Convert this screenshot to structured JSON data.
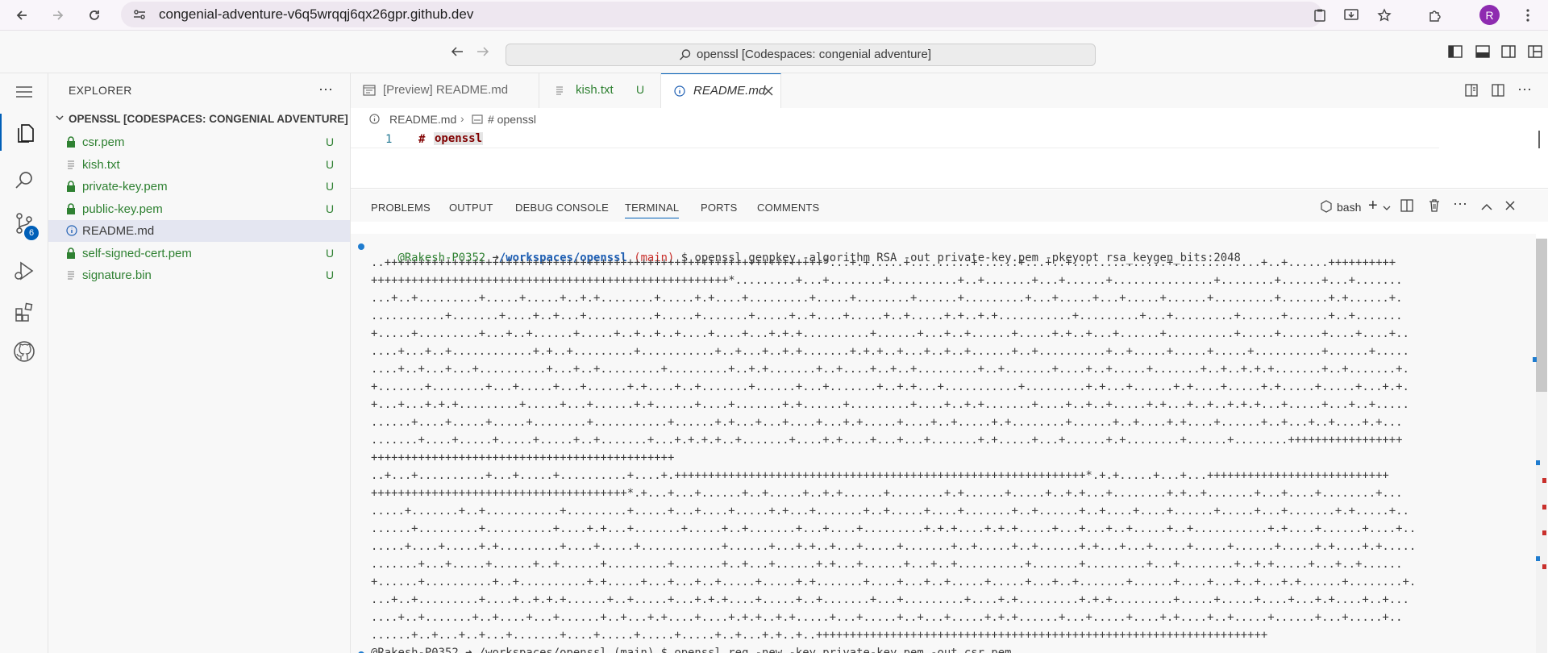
{
  "browser": {
    "url": "congenial-adventure-v6q5wrqqj6qx26gpr.github.dev",
    "avatar_letter": "R"
  },
  "titlebar": {
    "command_center": "openssl [Codespaces: congenial adventure]"
  },
  "activity": {
    "source_control_badge": "6"
  },
  "explorer": {
    "title": "EXPLORER",
    "folder": "OPENSSL [CODESPACES: CONGENIAL ADVENTURE]",
    "files": [
      {
        "name": "csr.pem",
        "status": "U"
      },
      {
        "name": "kish.txt",
        "status": "U"
      },
      {
        "name": "private-key.pem",
        "status": "U"
      },
      {
        "name": "public-key.pem",
        "status": "U"
      },
      {
        "name": "README.md",
        "status": ""
      },
      {
        "name": "self-signed-cert.pem",
        "status": "U"
      },
      {
        "name": "signature.bin",
        "status": "U"
      }
    ]
  },
  "tabs": [
    {
      "label": "[Preview] README.md",
      "status": ""
    },
    {
      "label": "kish.txt",
      "status": "U"
    },
    {
      "label": "README.md",
      "status": ""
    }
  ],
  "breadcrumb": {
    "file": "README.md",
    "symbol": "# openssl"
  },
  "editor": {
    "line_number": "1",
    "hash": "#",
    "heading": "openssl"
  },
  "panel": {
    "tabs": [
      "PROBLEMS",
      "OUTPUT",
      "DEBUG CONSOLE",
      "TERMINAL",
      "PORTS",
      "COMMENTS"
    ],
    "shell": "bash"
  },
  "terminal": {
    "prompt_user": "@Rakesh-P0352",
    "prompt_arrow": "➜",
    "prompt_path": "/workspaces/openssl",
    "prompt_branch": "(main)",
    "command": "$ openssl genpkey -algorithm RSA -out private-key.pem -pkeyopt rsa_keygen_bits:2048",
    "output_lines": [
      "..+++++++++++++++++++++++++++++++++++++++++++++++++++++++++++++++++*...+.+.....+.........+......+...+..+..............+.............+..+......++++++++++",
      "+++++++++++++++++++++++++++++++++++++++++++++++++++++*.........+...+........+..........+..+.......+...+......+...............+........+......+...+.......",
      "...+..+.........+.....+.....+..+.+........+.....+.+....+.........+.....+........+......+.........+...+.....+...+.....+......+.........+.......+.+......+.",
      "...........+.......+....+..+...+..........+.....+.......+.....+..+....+.....+..+.....+.+..+.+...........+.........+...+.........+......+......+..+.......",
      "+.....+.........+...+..+......+.....+..+..+..+....+....+...+.+.+..........+......+...+..+......+.....+.+..+...+......+..........+.....+......+....+....+..",
      "....+...+..+............+.+..+.........+...........+..+...+..+.+.......+.+.+..+...+..+..+......+..+..........+..+.....+.....+.....+..........+......+.....",
      "....+..+...+...+..........+...+..+.........+.........+..+.+.......+..+....+..+..+.........+..+.......+....+..+.....+.......+..+..+.+.+.......+..+.......+.",
      "+.......+........+...+.....+...+......+.+....+..+.......+......+...+.......+..+.+...+...........+.........+.+...+......+.+....+.....+.+.....+.....+...+.+.",
      "+...+...+.+.+.........+.....+...+......+.+......+....+.......+.+......+.........+....+..+.+.......+....+..+..+.....+.+...+..+..+.+.+...+.....+...+..+.....",
      "......+....+.....+.....+........+...........+......+.+...+...+....+...+.+.....+....+..+.....+.+........+......+..+....+.+....+......+..+...+..+....+.+...",
      ".......+....+.....+.....+.....+..+.......+...+.+.+.+..+.......+....+.+....+...+...+.......+.+.....+...+......+.+........+......+........+++++++++++++++++",
      "+++++++++++++++++++++++++++++++++++++++++++++",
      "..+...+..........+...+.....+..........+....+.+++++++++++++++++++++++++++++++++++++++++++++++++++++++++++++*.+.+.....+...+...+++++++++++++++++++++++++++",
      "++++++++++++++++++++++++++++++++++++++*.+...+...+......+..+.....+..+.+......+........+.+......+.....+..+.+...+........+.+..+.......+...+....+........+...",
      ".....+.......+..+...........+.........+.....+...+....+.....+.+...+.......+..+.....+....+.......+..+......+..+....+....+......+.....+...+.......+.+.....+..",
      "......+.........+..........+....+.+...+.......+.....+..+.......+...+....+.........+.+.+....+.+.+.....+...+...+..+.....+..+...........+.+....+......+....+..",
      ".....+....+.....+.+.........+....+.....+............+......+...+.+..+...+.....+.......+..+.....+..+......+.+...+...+.....+.....+......+.....+.+....+.+.....",
      ".......+...+.....+......+..+......+.........+.......+..+...+......+.+...+......+...+..+..........+.......+.........+...+........+..+.+.....+...+..+......",
      "+......+..........+..+..........+.+.....+...+...+..+.....+.....+.+.......+....+...+..+.....+.....+...+..+.......+......+....+...+..+...+.+......+........+.",
      "...+..+.........+....+..+.+.+......+..+.....+...+.+.+....+.....+..+.......+...+.........+....+.+.........+.+.+.........+.....+.....+....+...+.+....+..+...",
      "....+..+.......+..+....+...+......+..+...+.+....+....+.+.+..+.+.....+...+.....+..+...+.....+.+.+......+...+.....+....+.+....+..+.....+......+...+.....+..",
      "......+..+...+..+...+.......+....+.....+.....+.....+..+...+.+..+..+++++++++++++++++++++++++++++++++++++++++++++++++++++++++++++++++++"
    ],
    "next_command": "@Rakesh-P0352 ➜ /workspaces/openssl (main) $ openssl req -new -key private-key.pem -out csr.pem"
  },
  "colors": {
    "accent": "#005fb8",
    "untracked": "#2f8132",
    "prompt_path": "#1f5fb3",
    "branch": "#c9302c"
  }
}
